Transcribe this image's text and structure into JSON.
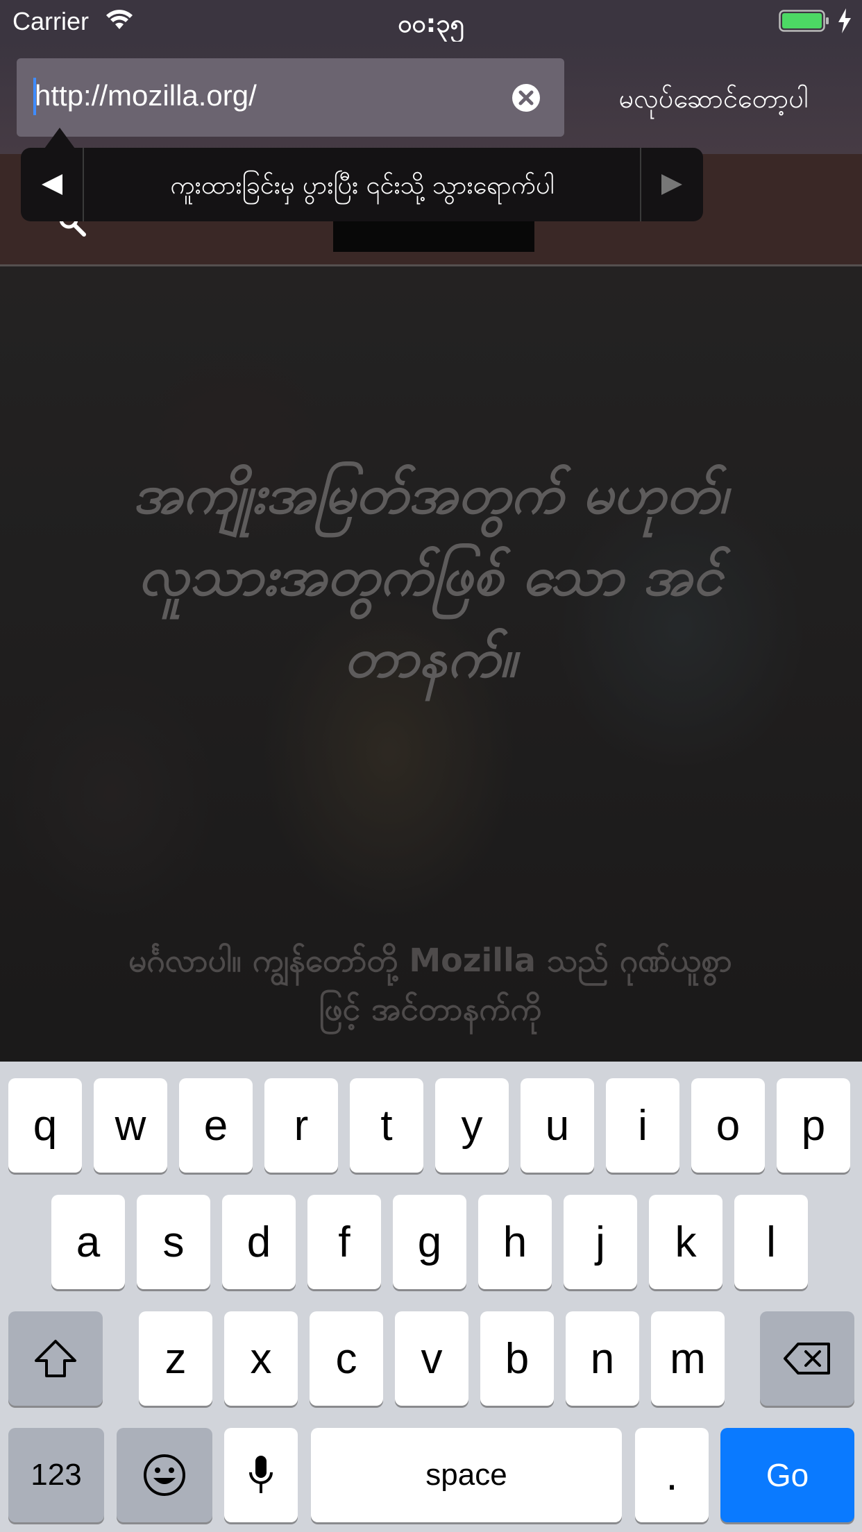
{
  "status_bar": {
    "carrier": "Carrier",
    "time": "၀၀:၃၅",
    "wifi_icon": "wifi-icon",
    "battery_icon": "battery-icon",
    "charging_icon": "lightning-bolt-icon"
  },
  "url_bar": {
    "url": "http://mozilla.org/",
    "clear_icon": "clear-circle-x-icon",
    "cancel_label": "မလုပ်ဆောင်တော့ပါ"
  },
  "callout": {
    "prev_icon": "triangle-left-icon",
    "next_icon": "triangle-right-icon",
    "label": "ကူးထားခြင်းမှ ပွားပြီး ၎င်းသို့ သွားရောက်ပါ"
  },
  "page": {
    "headline": "အကျိုးအမြတ်အတွက် မဟုတ်၊ လူသားအတွက်ဖြစ် သော အင်တာနက်။",
    "subtext": "မင်္ဂလာပါ။ ကျွန်တော်တို့ Mozilla သည် ဂုဏ်ယူစွာဖြင့် အင်တာနက်ကို"
  },
  "keyboard": {
    "row1": [
      "q",
      "w",
      "e",
      "r",
      "t",
      "y",
      "u",
      "i",
      "o",
      "p"
    ],
    "row2": [
      "a",
      "s",
      "d",
      "f",
      "g",
      "h",
      "j",
      "k",
      "l"
    ],
    "row3": [
      "z",
      "x",
      "c",
      "v",
      "b",
      "n",
      "m"
    ],
    "shift_icon": "shift-arrow-icon",
    "delete_icon": "backspace-icon",
    "numbers_label": "123",
    "emoji_icon": "emoji-face-icon",
    "mic_icon": "microphone-icon",
    "space_label": "space",
    "period_label": ".",
    "go_label": "Go"
  },
  "colors": {
    "accent": "#0a7aff",
    "toolbar": "#3b3540",
    "keyboard_bg": "#d1d4da"
  }
}
